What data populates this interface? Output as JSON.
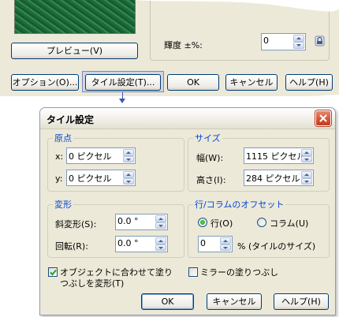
{
  "background_dialog": {
    "preview_button": "プレビュー(V)",
    "brightness_label": "輝度 ±%:",
    "brightness_value": "0",
    "options_button": "オプション(O)...",
    "tile_settings_button": "タイル設定(T)...",
    "ok_button": "OK",
    "cancel_button": "キャンセル",
    "help_button": "ヘルプ(H)"
  },
  "dialog": {
    "title": "タイル設定",
    "origin": {
      "title": "原点",
      "x_label": "x:",
      "x_value": "0 ピクセル",
      "y_label": "y:",
      "y_value": "0 ピクセル"
    },
    "size": {
      "title": "サイズ",
      "width_label": "幅(W):",
      "width_value": "1115 ピクセル",
      "height_label": "高さ(I):",
      "height_value": "284 ピクセル"
    },
    "transform": {
      "title": "変形",
      "skew_label": "斜変形(S):",
      "skew_value": "0.0 °",
      "rotate_label": "回転(R):",
      "rotate_value": "0.0 °"
    },
    "offset": {
      "title": "行/コラムのオフセット",
      "row_label": "行(O)",
      "column_label": "コラム(U)",
      "selected": "row",
      "value": "0",
      "unit_label": "% (タイルのサイズ)"
    },
    "transform_fill_label_line1": "オブジェクトに合わせて塗り",
    "transform_fill_label_line2": "つぶしを変形(T)",
    "transform_fill_checked": true,
    "mirror_fill_label": "ミラーの塗りつぶし",
    "mirror_fill_checked": false,
    "ok_button": "OK",
    "cancel_button": "キャンセル",
    "help_button": "ヘルプ(H)"
  },
  "colors": {
    "dialog_bg": "#ece9d8",
    "group_title": "#0046d5",
    "close_button": "#d55233",
    "highlight": "#7b86c9"
  }
}
